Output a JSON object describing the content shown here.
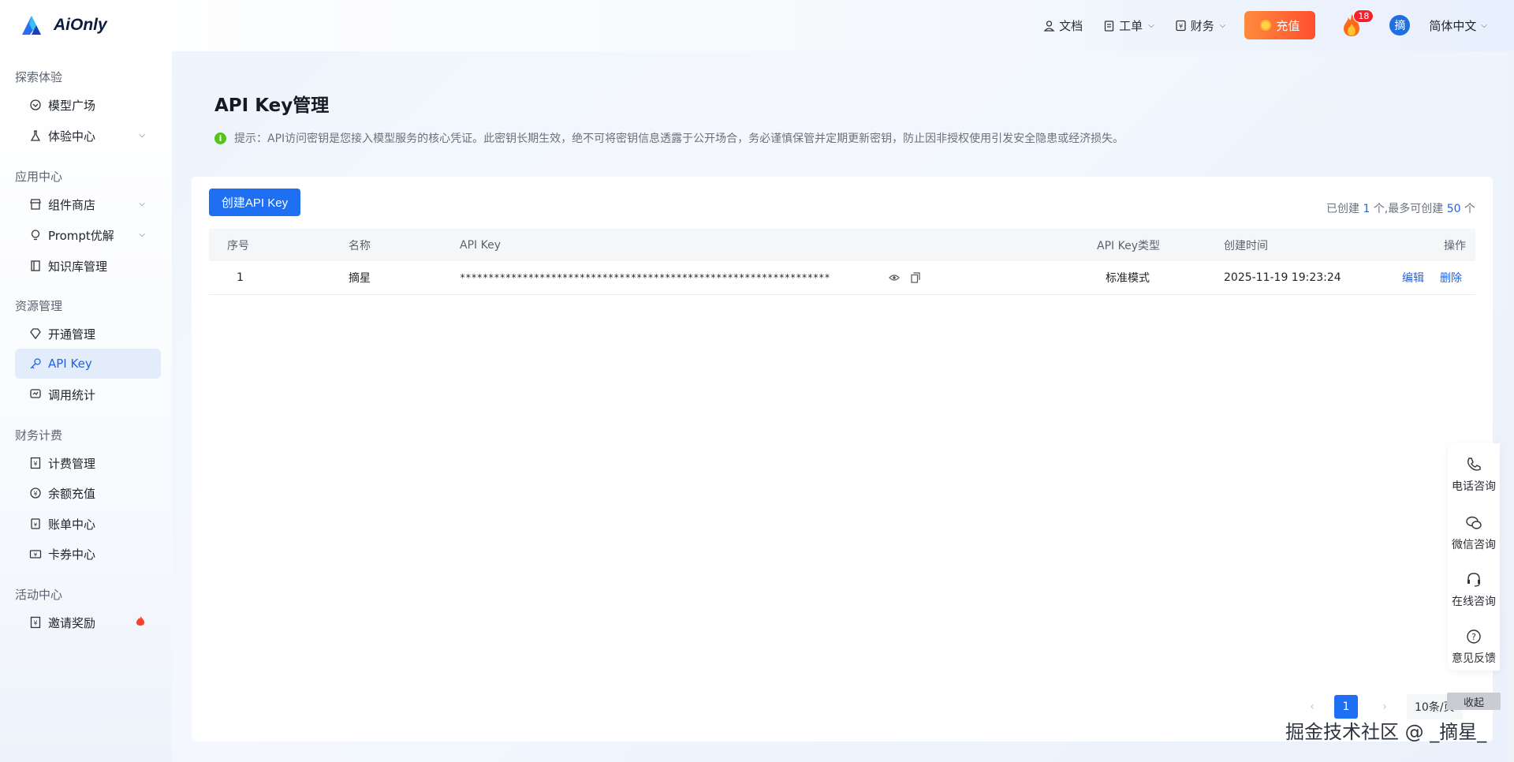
{
  "header": {
    "logo_text": "AiOnly",
    "nav": [
      {
        "label": "文档",
        "icon": "user-doc-icon"
      },
      {
        "label": "工单",
        "icon": "clipboard-icon"
      },
      {
        "label": "财务",
        "icon": "yen-icon"
      }
    ],
    "recharge_label": "充值",
    "notification_count": "18",
    "avatar_text": "摘",
    "language": "简体中文"
  },
  "sidebar": {
    "groups": [
      {
        "title": "探索体验",
        "items": [
          {
            "label": "模型广场"
          },
          {
            "label": "体验中心"
          }
        ]
      },
      {
        "title": "应用中心",
        "items": [
          {
            "label": "组件商店"
          },
          {
            "label": "Prompt优解"
          },
          {
            "label": "知识库管理"
          }
        ]
      },
      {
        "title": "资源管理",
        "items": [
          {
            "label": "开通管理"
          },
          {
            "label": "API Key"
          },
          {
            "label": "调用统计"
          }
        ]
      },
      {
        "title": "财务计费",
        "items": [
          {
            "label": "计费管理"
          },
          {
            "label": "余额充值"
          },
          {
            "label": "账单中心"
          },
          {
            "label": "卡券中心"
          }
        ]
      },
      {
        "title": "活动中心",
        "items": [
          {
            "label": "邀请奖励"
          }
        ]
      }
    ]
  },
  "page": {
    "title": "API Key管理",
    "tip_icon": "i",
    "tip": "提示：API访问密钥是您接入模型服务的核心凭证。此密钥长期生效，绝不可将密钥信息透露于公开场合，务必谨慎保管并定期更新密钥，防止因非授权使用引发安全隐患或经济损失。",
    "create_button": "创建API Key",
    "quota": {
      "prefix": "已创建",
      "created": "1",
      "middle": "个,最多可创建",
      "max": "50",
      "suffix": "个"
    }
  },
  "table": {
    "columns": [
      "序号",
      "名称",
      "API Key",
      "API Key类型",
      "创建时间",
      "操作"
    ],
    "rows": [
      {
        "index": "1",
        "name": "摘星",
        "key": "*****************************************************************",
        "type": "标准模式",
        "created": "2025-11-19 19:23:24",
        "edit": "编辑",
        "delete": "删除"
      }
    ]
  },
  "pagination": {
    "prev": "‹",
    "current": "1",
    "next": "›",
    "page_size": "10条/页"
  },
  "float_tools": [
    {
      "label": "电话咨询",
      "icon": "phone-icon"
    },
    {
      "label": "微信咨询",
      "icon": "wechat-icon"
    },
    {
      "label": "在线咨询",
      "icon": "headset-icon"
    },
    {
      "label": "意见反馈",
      "icon": "question-icon"
    }
  ],
  "collapse_label": "收起",
  "watermark": "掘金技术社区 @ _摘星_",
  "colors": {
    "primary": "#1e6ff2",
    "recharge": "#ff5a2f",
    "success": "#52c41a",
    "badge": "#f5222d"
  }
}
